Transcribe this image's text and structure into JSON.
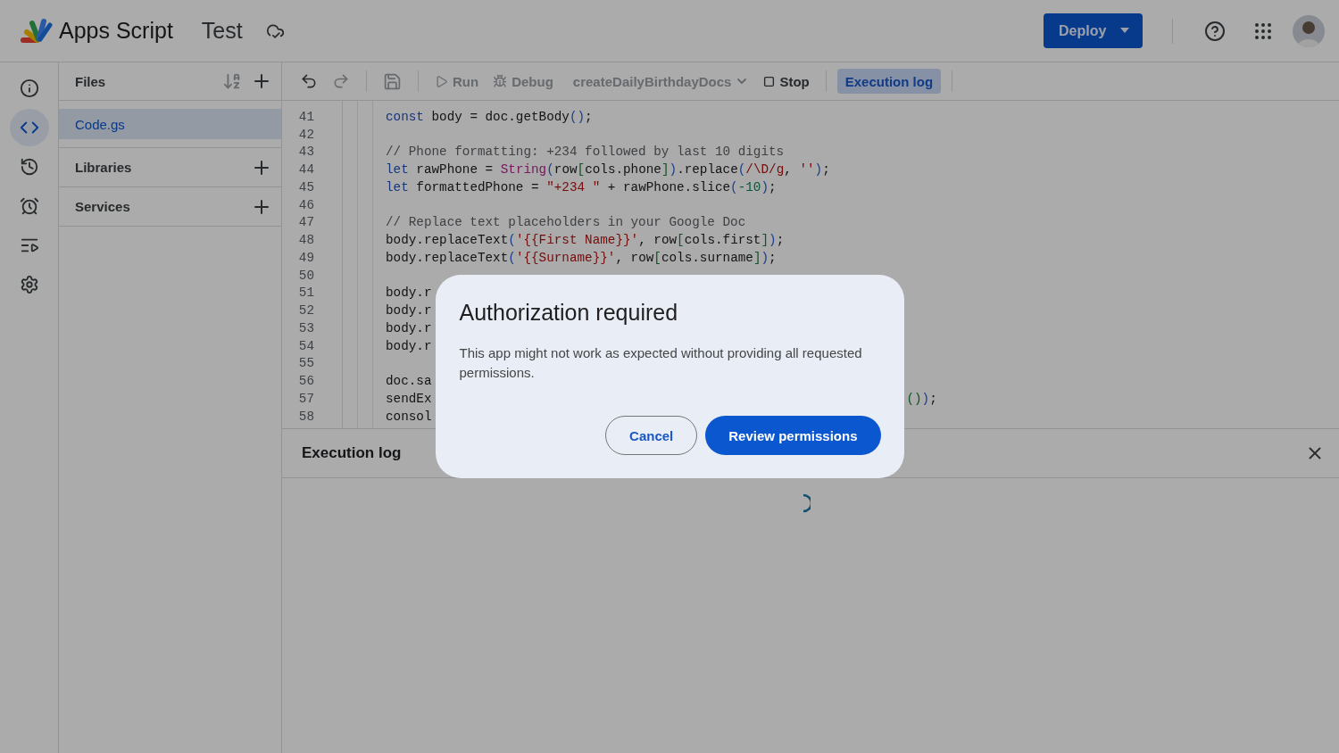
{
  "header": {
    "product": "Apps Script",
    "project": "Test",
    "deploy": "Deploy"
  },
  "rail": [
    {
      "kind": "info",
      "selected": false
    },
    {
      "kind": "code",
      "selected": true
    },
    {
      "kind": "history",
      "selected": false
    },
    {
      "kind": "triggers",
      "selected": false
    },
    {
      "kind": "executions",
      "selected": false
    },
    {
      "kind": "settings",
      "selected": false
    }
  ],
  "files_panel": {
    "title": "Files",
    "files": [
      {
        "name": "Code.gs",
        "selected": true
      }
    ],
    "sections": [
      "Libraries",
      "Services"
    ]
  },
  "toolbar": {
    "run": {
      "label": "Run",
      "disabled": true
    },
    "debug": {
      "label": "Debug",
      "disabled": true
    },
    "function": "createDailyBirthdayDocs",
    "stop": "Stop",
    "log_toggle": {
      "label": "Execution log",
      "selected": true
    }
  },
  "code": {
    "lines": [
      {
        "number": "41",
        "tokens": [
          {
            "kind": "keyword",
            "s": "const"
          },
          {
            "kind": "plain",
            "s": " body = doc.getBody"
          },
          {
            "kind": "paren",
            "s": "()"
          },
          {
            "kind": "plain",
            "s": ";"
          }
        ]
      },
      {
        "number": "42"
      },
      {
        "number": "43",
        "tokens": [
          {
            "kind": "comment",
            "s": "// Phone formatting: +234 followed by last 10 digits"
          }
        ]
      },
      {
        "number": "44",
        "tokens": [
          {
            "kind": "keyword",
            "s": "let"
          },
          {
            "kind": "plain",
            "s": " rawPhone = "
          },
          {
            "kind": "function",
            "s": "String"
          },
          {
            "kind": "paren",
            "s": "("
          },
          {
            "kind": "plain",
            "s": "row"
          },
          {
            "kind": "bracket",
            "s": "["
          },
          {
            "kind": "plain",
            "s": "cols.phone"
          },
          {
            "kind": "bracket",
            "s": "]"
          },
          {
            "kind": "paren",
            "s": ")"
          },
          {
            "kind": "plain",
            "s": ".replace"
          },
          {
            "kind": "paren",
            "s": "("
          },
          {
            "kind": "string",
            "s": "/\\D/g"
          },
          {
            "kind": "plain",
            "s": ", "
          },
          {
            "kind": "string",
            "s": "''"
          },
          {
            "kind": "paren",
            "s": ")"
          },
          {
            "kind": "plain",
            "s": ";"
          }
        ]
      },
      {
        "number": "45",
        "tokens": [
          {
            "kind": "keyword",
            "s": "let"
          },
          {
            "kind": "plain",
            "s": " formattedPhone = "
          },
          {
            "kind": "string",
            "s": "\"+234 \""
          },
          {
            "kind": "plain",
            "s": " + rawPhone.slice"
          },
          {
            "kind": "paren",
            "s": "("
          },
          {
            "kind": "number",
            "s": "-10"
          },
          {
            "kind": "paren",
            "s": ")"
          },
          {
            "kind": "plain",
            "s": ";"
          }
        ]
      },
      {
        "number": "46"
      },
      {
        "number": "47",
        "tokens": [
          {
            "kind": "comment",
            "s": "// Replace text placeholders in your Google Doc"
          }
        ]
      },
      {
        "number": "48",
        "tokens": [
          {
            "kind": "plain",
            "s": "body.replaceText"
          },
          {
            "kind": "paren",
            "s": "("
          },
          {
            "kind": "string",
            "s": "'{{First Name}}'"
          },
          {
            "kind": "plain",
            "s": ", row"
          },
          {
            "kind": "bracket",
            "s": "["
          },
          {
            "kind": "plain",
            "s": "cols.first"
          },
          {
            "kind": "bracket",
            "s": "]"
          },
          {
            "kind": "paren",
            "s": ")"
          },
          {
            "kind": "plain",
            "s": ";"
          }
        ]
      },
      {
        "number": "49",
        "tokens": [
          {
            "kind": "plain",
            "s": "body.replaceText"
          },
          {
            "kind": "paren",
            "s": "("
          },
          {
            "kind": "string",
            "s": "'{{Surname}}'"
          },
          {
            "kind": "plain",
            "s": ", row"
          },
          {
            "kind": "bracket",
            "s": "["
          },
          {
            "kind": "plain",
            "s": "cols.surname"
          },
          {
            "kind": "bracket",
            "s": "]"
          },
          {
            "kind": "paren",
            "s": ")"
          },
          {
            "kind": "plain",
            "s": ";"
          }
        ]
      },
      {
        "number": "50"
      },
      {
        "number": "51",
        "tokens": [
          {
            "kind": "plain",
            "s": "body.r"
          }
        ]
      },
      {
        "number": "52",
        "tokens": [
          {
            "kind": "plain",
            "s": "body.r"
          }
        ]
      },
      {
        "number": "53",
        "tokens": [
          {
            "kind": "plain",
            "s": "body.r"
          }
        ]
      },
      {
        "number": "54",
        "tokens": [
          {
            "kind": "plain",
            "s": "body.r"
          }
        ]
      },
      {
        "number": "55"
      },
      {
        "number": "56",
        "tokens": [
          {
            "kind": "plain",
            "s": "doc.sa"
          }
        ]
      },
      {
        "number": "57",
        "tokens": [
          {
            "kind": "plain",
            "s": "sendEx"
          }
        ],
        "tail": [
          {
            "kind": "bracket",
            "s": "()"
          },
          {
            "kind": "paren",
            "s": ")"
          },
          {
            "kind": "plain",
            "s": ";"
          }
        ]
      },
      {
        "number": "58",
        "tokens": [
          {
            "kind": "plain",
            "s": "consol"
          }
        ]
      }
    ]
  },
  "execution_log": {
    "title": "Execution log",
    "loading": true
  },
  "dialog": {
    "title": "Authorization required",
    "message": "This app might not work as expected without providing all requested permissions.",
    "buttons": [
      {
        "kind": "secondary",
        "label": "Cancel"
      },
      {
        "kind": "primary",
        "label": "Review permissions"
      }
    ]
  }
}
